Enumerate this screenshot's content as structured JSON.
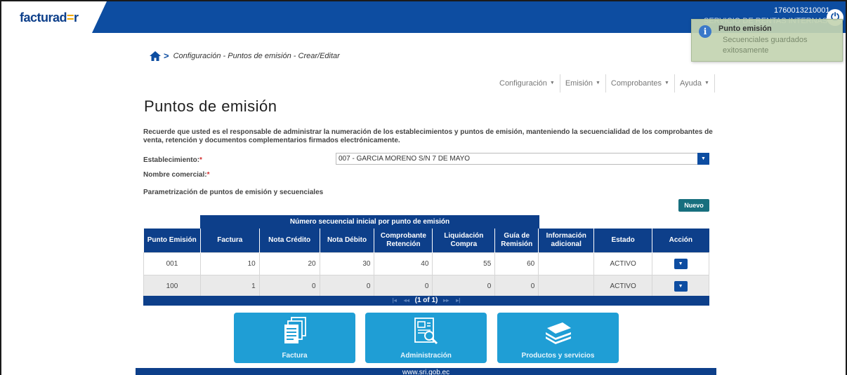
{
  "header": {
    "logo_main": "facturad",
    "logo_mid": "=",
    "logo_end": "r",
    "ruc": "1760013210001",
    "org": "SERVICIO DE RENTAS INTERNAS",
    "power_icon": "power-icon"
  },
  "toast": {
    "title": "Punto emisión",
    "message": "Secuenciales guardados exitosamente",
    "icon": "info-icon"
  },
  "breadcrumb": {
    "separator": ">",
    "text": "Configuración - Puntos de emisión - Crear/Editar"
  },
  "menu": [
    {
      "label": "Configuración"
    },
    {
      "label": "Emisión"
    },
    {
      "label": "Comprobantes"
    },
    {
      "label": "Ayuda"
    }
  ],
  "page": {
    "title": "Puntos de emisión",
    "notice": "Recuerde que usted es el responsable de administrar la numeración de los establecimientos y puntos de emisión, manteniendo la secuencialidad de los comprobantes de venta, retención y documentos complementarios firmados electrónicamente.",
    "establecimiento_label": "Establecimiento:",
    "establecimiento_value": "007 - GARCIA MORENO S/N 7 DE MAYO",
    "nombre_comercial_label": "Nombre comercial:",
    "required_mark": "*",
    "section_title": "Parametrización de puntos de emisión y secuenciales",
    "nuevo_label": "Nuevo"
  },
  "table": {
    "group_header": "Número secuencial inicial por punto de emisión",
    "columns": [
      "Punto Emisión",
      "Factura",
      "Nota Crédito",
      "Nota Débito",
      "Comprobante Retención",
      "Liquidación Compra",
      "Guía de Remisión",
      "Información adicional",
      "Estado",
      "Acción"
    ],
    "rows": [
      {
        "punto": "001",
        "factura": "10",
        "nota_credito": "20",
        "nota_debito": "30",
        "retencion": "40",
        "liquidacion": "55",
        "guia": "60",
        "info": "",
        "estado": "ACTIVO"
      },
      {
        "punto": "100",
        "factura": "1",
        "nota_credito": "0",
        "nota_debito": "0",
        "retencion": "0",
        "liquidacion": "0",
        "guia": "0",
        "info": "",
        "estado": "ACTIVO"
      }
    ],
    "pager": "(1 of 1)"
  },
  "tiles": [
    {
      "label": "Factura",
      "icon": "documents-icon"
    },
    {
      "label": "Administración",
      "icon": "admin-report-icon"
    },
    {
      "label": "Productos y servicios",
      "icon": "products-stack-icon"
    }
  ],
  "footer": {
    "text": "www.sri.gob.ec"
  },
  "colors": {
    "primary": "#0d3f8a",
    "topbar": "#0d4da1",
    "tile": "#1f9ed5",
    "nuevo": "#176f7e",
    "required": "#d32f2f"
  }
}
